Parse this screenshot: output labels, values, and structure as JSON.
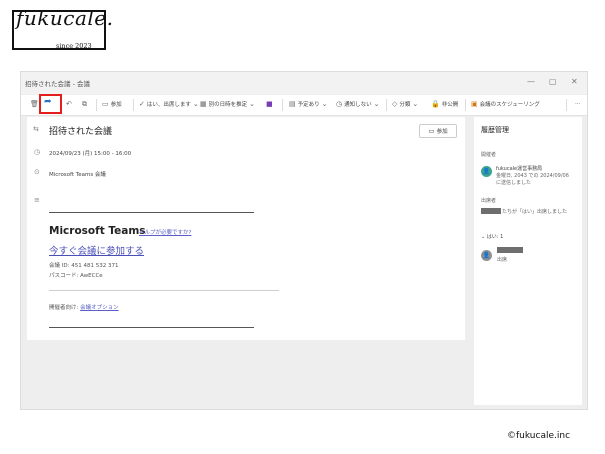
{
  "logo": {
    "name": "fukucale.",
    "since": "since 2023"
  },
  "window": {
    "title": "招待された会議 - 会議",
    "controls": [
      "—",
      "▢",
      "✕"
    ]
  },
  "toolbar": {
    "forward_caption": "転送",
    "items": [
      {
        "label": "参加",
        "icon": "camera-icon"
      },
      {
        "label": "はい、出席します",
        "icon": "check-icon"
      },
      {
        "label": "別の日時を推定",
        "icon": "calendar-icon"
      },
      {
        "label": "予定あり",
        "icon": "briefcase-icon"
      },
      {
        "label": "通知しない",
        "icon": "clock-icon"
      },
      {
        "label": "分類",
        "icon": "tag-icon"
      },
      {
        "label": "非公開",
        "icon": "lock-icon"
      },
      {
        "label": "会議のスケジューリング",
        "icon": "scheduling-icon"
      }
    ],
    "more": "…"
  },
  "meeting": {
    "title": "招待された会議",
    "datetime": "2024/09/23 (月) 15:00 - 16:00",
    "location": "Microsoft Teams 会議",
    "join_button": "参加"
  },
  "body": {
    "teams_heading": "Microsoft Teams",
    "help_link": "ヘルプが必要ですか?",
    "join_link": "今すぐ会議に参加する",
    "meeting_id": "会議 ID: 451 481 532 371",
    "passcode": "パスコード: AwECCe",
    "organizer_prefix": "開催者向け:",
    "organizer_link": "会議オプション"
  },
  "right_pane": {
    "title": "履歴管理",
    "organizer_label": "開催者",
    "organizer_name": "fukucale運営事務局",
    "organizer_detail_1": "金曜日, 2043 での 2024/09/06",
    "organizer_detail_2": "に送信しました",
    "attendee_label": "出席者",
    "attendee_note": "たちが「はい」出席しました",
    "accepted_label": "はい: 1",
    "accepted_status": "出席"
  },
  "copyright": "©fukucale.inc"
}
